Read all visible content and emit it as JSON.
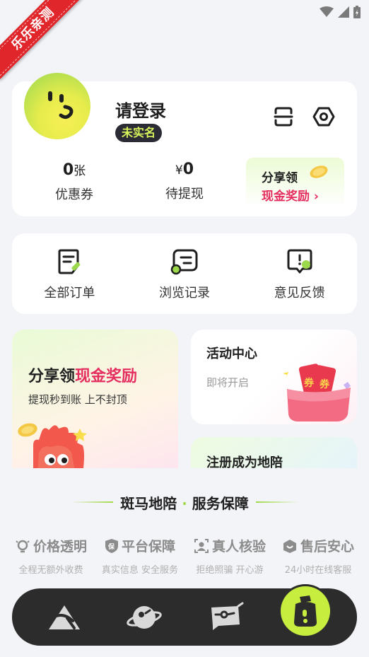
{
  "ribbon": "乐乐亲测",
  "profile": {
    "login_title": "请登录",
    "badge": "未实名",
    "stats": [
      {
        "value": "0",
        "unit": "张",
        "label": "优惠券"
      },
      {
        "prefix": "¥",
        "value": "0",
        "label": "待提现"
      }
    ],
    "share_title": "分享领",
    "share_link": "现金奖励 ›"
  },
  "menu": [
    {
      "label": "全部订单",
      "icon": "orders-icon"
    },
    {
      "label": "浏览记录",
      "icon": "history-icon"
    },
    {
      "label": "意见反馈",
      "icon": "feedback-icon"
    }
  ],
  "promos": {
    "left_title_a": "分享领",
    "left_title_b": "现金奖励",
    "left_sub": "提现秒到账 上不封顶",
    "right_top_title": "活动中心",
    "right_top_sub": "即将开启",
    "right_bottom_title": "注册成为地陪"
  },
  "guarantee": {
    "title_a": "斑马地陪",
    "title_dot": "·",
    "title_b": "服务保障",
    "items": [
      {
        "title": "价格透明",
        "desc": "全程无额外收费",
        "icon": "bulb-icon"
      },
      {
        "title": "平台保障",
        "desc": "真实信息 安全服务",
        "icon": "shield-icon"
      },
      {
        "title": "真人核验",
        "desc": "拒绝照骗 开心游",
        "icon": "person-icon"
      },
      {
        "title": "售后安心",
        "desc": "24小时在线客服",
        "icon": "service-icon"
      }
    ]
  },
  "colors": {
    "accent_green": "#c7ee3e",
    "accent_pink": "#e52e60",
    "dark": "#2c2c2c"
  }
}
